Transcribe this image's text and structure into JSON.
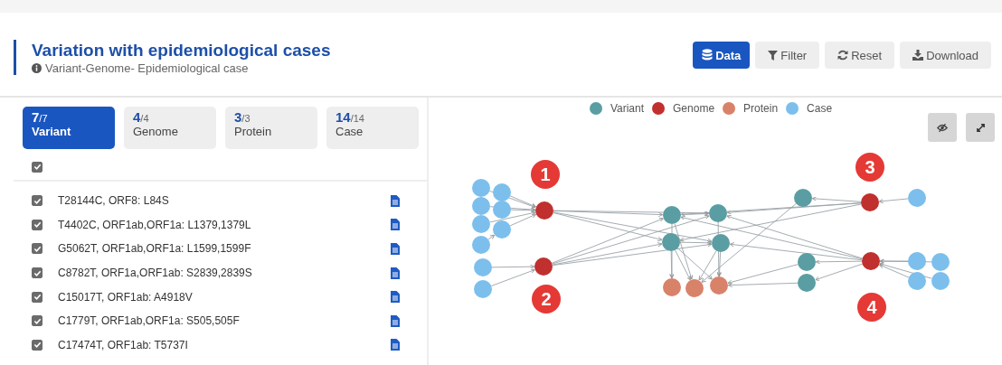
{
  "header": {
    "title": "Variation with epidemiological cases",
    "subtitle": "Variant-Genome- Epidemiological case"
  },
  "buttons": [
    {
      "label": "Data",
      "kind": "data",
      "selected": true
    },
    {
      "label": "Filter",
      "kind": "filter",
      "selected": false
    },
    {
      "label": "Reset",
      "kind": "reset",
      "selected": false
    },
    {
      "label": "Download",
      "kind": "download",
      "selected": false
    }
  ],
  "tabs": [
    {
      "count": "7",
      "total": "/7",
      "label": "Variant",
      "selected": true
    },
    {
      "count": "4",
      "total": "/4",
      "label": "Genome",
      "selected": false
    },
    {
      "count": "3",
      "total": "/3",
      "label": "Protein",
      "selected": false
    },
    {
      "count": "14",
      "total": "/14",
      "label": "Case",
      "selected": false
    }
  ],
  "select_all": {
    "checked": true
  },
  "variants": [
    {
      "label": "T28144C, ORF8: L84S",
      "checked": true
    },
    {
      "label": "T4402C, ORF1ab,ORF1a: L1379,1379L",
      "checked": true
    },
    {
      "label": "G5062T, ORF1ab,ORF1a: L1599,1599F",
      "checked": true
    },
    {
      "label": "C8782T, ORF1a,ORF1ab: S2839,2839S",
      "checked": true
    },
    {
      "label": "C15017T, ORF1ab: A4918V",
      "checked": true
    },
    {
      "label": "C1779T, ORF1ab,ORF1a: S505,505F",
      "checked": true
    },
    {
      "label": "C17474T, ORF1ab: T5737I",
      "checked": true
    }
  ],
  "legend": [
    {
      "label": "Variant",
      "color": "#5a9ea3"
    },
    {
      "label": "Genome",
      "color": "#c0302e"
    },
    {
      "label": "Protein",
      "color": "#d9826a"
    },
    {
      "label": "Case",
      "color": "#7cbfec"
    }
  ],
  "badges": [
    "1",
    "2",
    "3",
    "4"
  ]
}
